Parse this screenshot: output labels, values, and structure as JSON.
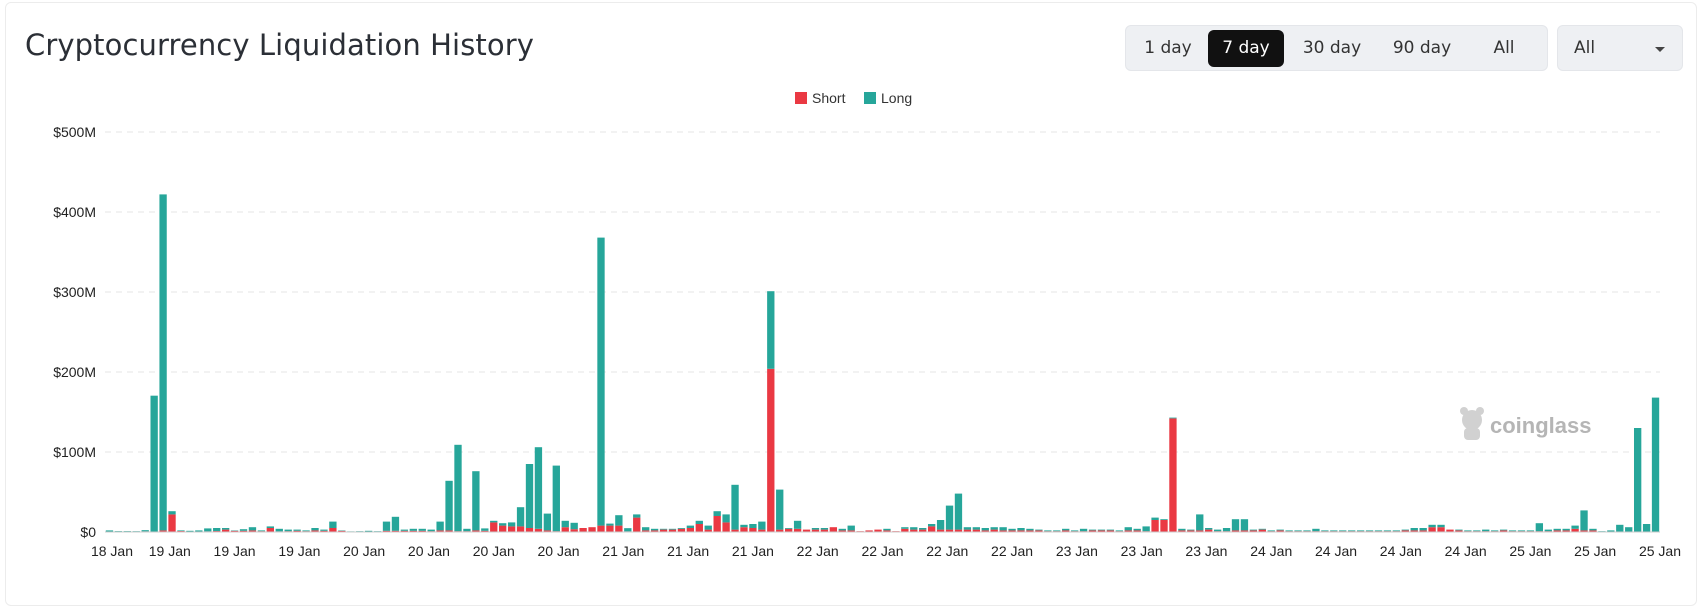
{
  "title": "Cryptocurrency Liquidation History",
  "range_buttons": [
    {
      "label": "1 day",
      "active": false
    },
    {
      "label": "7 day",
      "active": true
    },
    {
      "label": "30 day",
      "active": false
    },
    {
      "label": "90 day",
      "active": false
    },
    {
      "label": "All",
      "active": false
    }
  ],
  "select": {
    "value": "All"
  },
  "watermark": "coinglass",
  "colors": {
    "short": "#ea3943",
    "long": "#26a69a",
    "grid": "#e6e6e6",
    "axis": "#cccccc"
  },
  "chart_data": {
    "type": "bar",
    "stacked": true,
    "legend_position": "top-center",
    "grid": true,
    "ylim": [
      0,
      500
    ],
    "y_unit": "M USD",
    "y_ticks": [
      "$0",
      "$100M",
      "$200M",
      "$300M",
      "$400M",
      "$500M"
    ],
    "x_tick_labels": [
      "18 Jan",
      "19 Jan",
      "19 Jan",
      "19 Jan",
      "20 Jan",
      "20 Jan",
      "20 Jan",
      "20 Jan",
      "21 Jan",
      "21 Jan",
      "21 Jan",
      "22 Jan",
      "22 Jan",
      "22 Jan",
      "22 Jan",
      "23 Jan",
      "23 Jan",
      "23 Jan",
      "24 Jan",
      "24 Jan",
      "24 Jan",
      "24 Jan",
      "25 Jan",
      "25 Jan",
      "25 Jan"
    ],
    "series": [
      {
        "name": "Short",
        "values": [
          0.5,
          0.3,
          0.3,
          0.5,
          0.8,
          0.4,
          2,
          22,
          1.2,
          0.6,
          0.5,
          0.8,
          1.2,
          3,
          1.5,
          1.5,
          2,
          1,
          5,
          0.8,
          1,
          1.5,
          1,
          2,
          1.5,
          5,
          1.5,
          0.3,
          0.5,
          0.5,
          0.5,
          1.5,
          1.5,
          1.5,
          1.5,
          1.5,
          1,
          2,
          2,
          1,
          1,
          2,
          1.5,
          12,
          8,
          7,
          7,
          5,
          4,
          2,
          1,
          6,
          3.5,
          5,
          6,
          8,
          8,
          8,
          0.8,
          18,
          2,
          2,
          3,
          3,
          4,
          5,
          10,
          3,
          20,
          12,
          3,
          6,
          5,
          3,
          204,
          3,
          4,
          4,
          3,
          3,
          3,
          6,
          2,
          2,
          1,
          2,
          3,
          2,
          1,
          4,
          3,
          3,
          7,
          3,
          3,
          3,
          3,
          3,
          2,
          3,
          2,
          2,
          2,
          2,
          2,
          1,
          1,
          2,
          1,
          1,
          2,
          2,
          2,
          1,
          2,
          2,
          1,
          15,
          15,
          142,
          2,
          2,
          2,
          3,
          1,
          1,
          2,
          2,
          2,
          3,
          1,
          2,
          1,
          1,
          1,
          1,
          1,
          1,
          1,
          1,
          1,
          1,
          1,
          1,
          1,
          2,
          2,
          2,
          6,
          6,
          3,
          2,
          1,
          1,
          1,
          1,
          2,
          1,
          1,
          1,
          1,
          1,
          2,
          2,
          4,
          2,
          2
        ]
      },
      {
        "name": "Long",
        "values": [
          1.5,
          0.8,
          0.8,
          0.5,
          1.5,
          170,
          420,
          4,
          0.8,
          0.9,
          1.5,
          3.7,
          3.8,
          2,
          0.5,
          2,
          4,
          1,
          2,
          3.2,
          2,
          1.5,
          1,
          3,
          1.5,
          8,
          0.5,
          0.5,
          0.5,
          1,
          0.5,
          11.5,
          17.5,
          1.5,
          2.5,
          2.5,
          2,
          11,
          62,
          108,
          3,
          74,
          3,
          2,
          3,
          5,
          24,
          80,
          102,
          21,
          82,
          8,
          8,
          0,
          0,
          360,
          2.5,
          13,
          4,
          4,
          4,
          2,
          1,
          1,
          1,
          3,
          4,
          5,
          6,
          10,
          56,
          3,
          5,
          10,
          97,
          50,
          1,
          10,
          0,
          2,
          2,
          0,
          2,
          6,
          0,
          0,
          0,
          2,
          0,
          2,
          3,
          2,
          3,
          12,
          30,
          45,
          3,
          3,
          3,
          3,
          4,
          2,
          3,
          2,
          1,
          1,
          1,
          2,
          1,
          3,
          1,
          1,
          1,
          1,
          4,
          2,
          6,
          3,
          1,
          1,
          2,
          1,
          20,
          2,
          2,
          4,
          14,
          14,
          1,
          1,
          1,
          1,
          1,
          1,
          1,
          3,
          1,
          1,
          1,
          1,
          1,
          1,
          1,
          1,
          1,
          1,
          3,
          3,
          3,
          3,
          0,
          1,
          1,
          1,
          2,
          1,
          1,
          1,
          1,
          1,
          10,
          2,
          2,
          2,
          4,
          25,
          2,
          1,
          2,
          9,
          6,
          130,
          10,
          168
        ]
      }
    ]
  }
}
